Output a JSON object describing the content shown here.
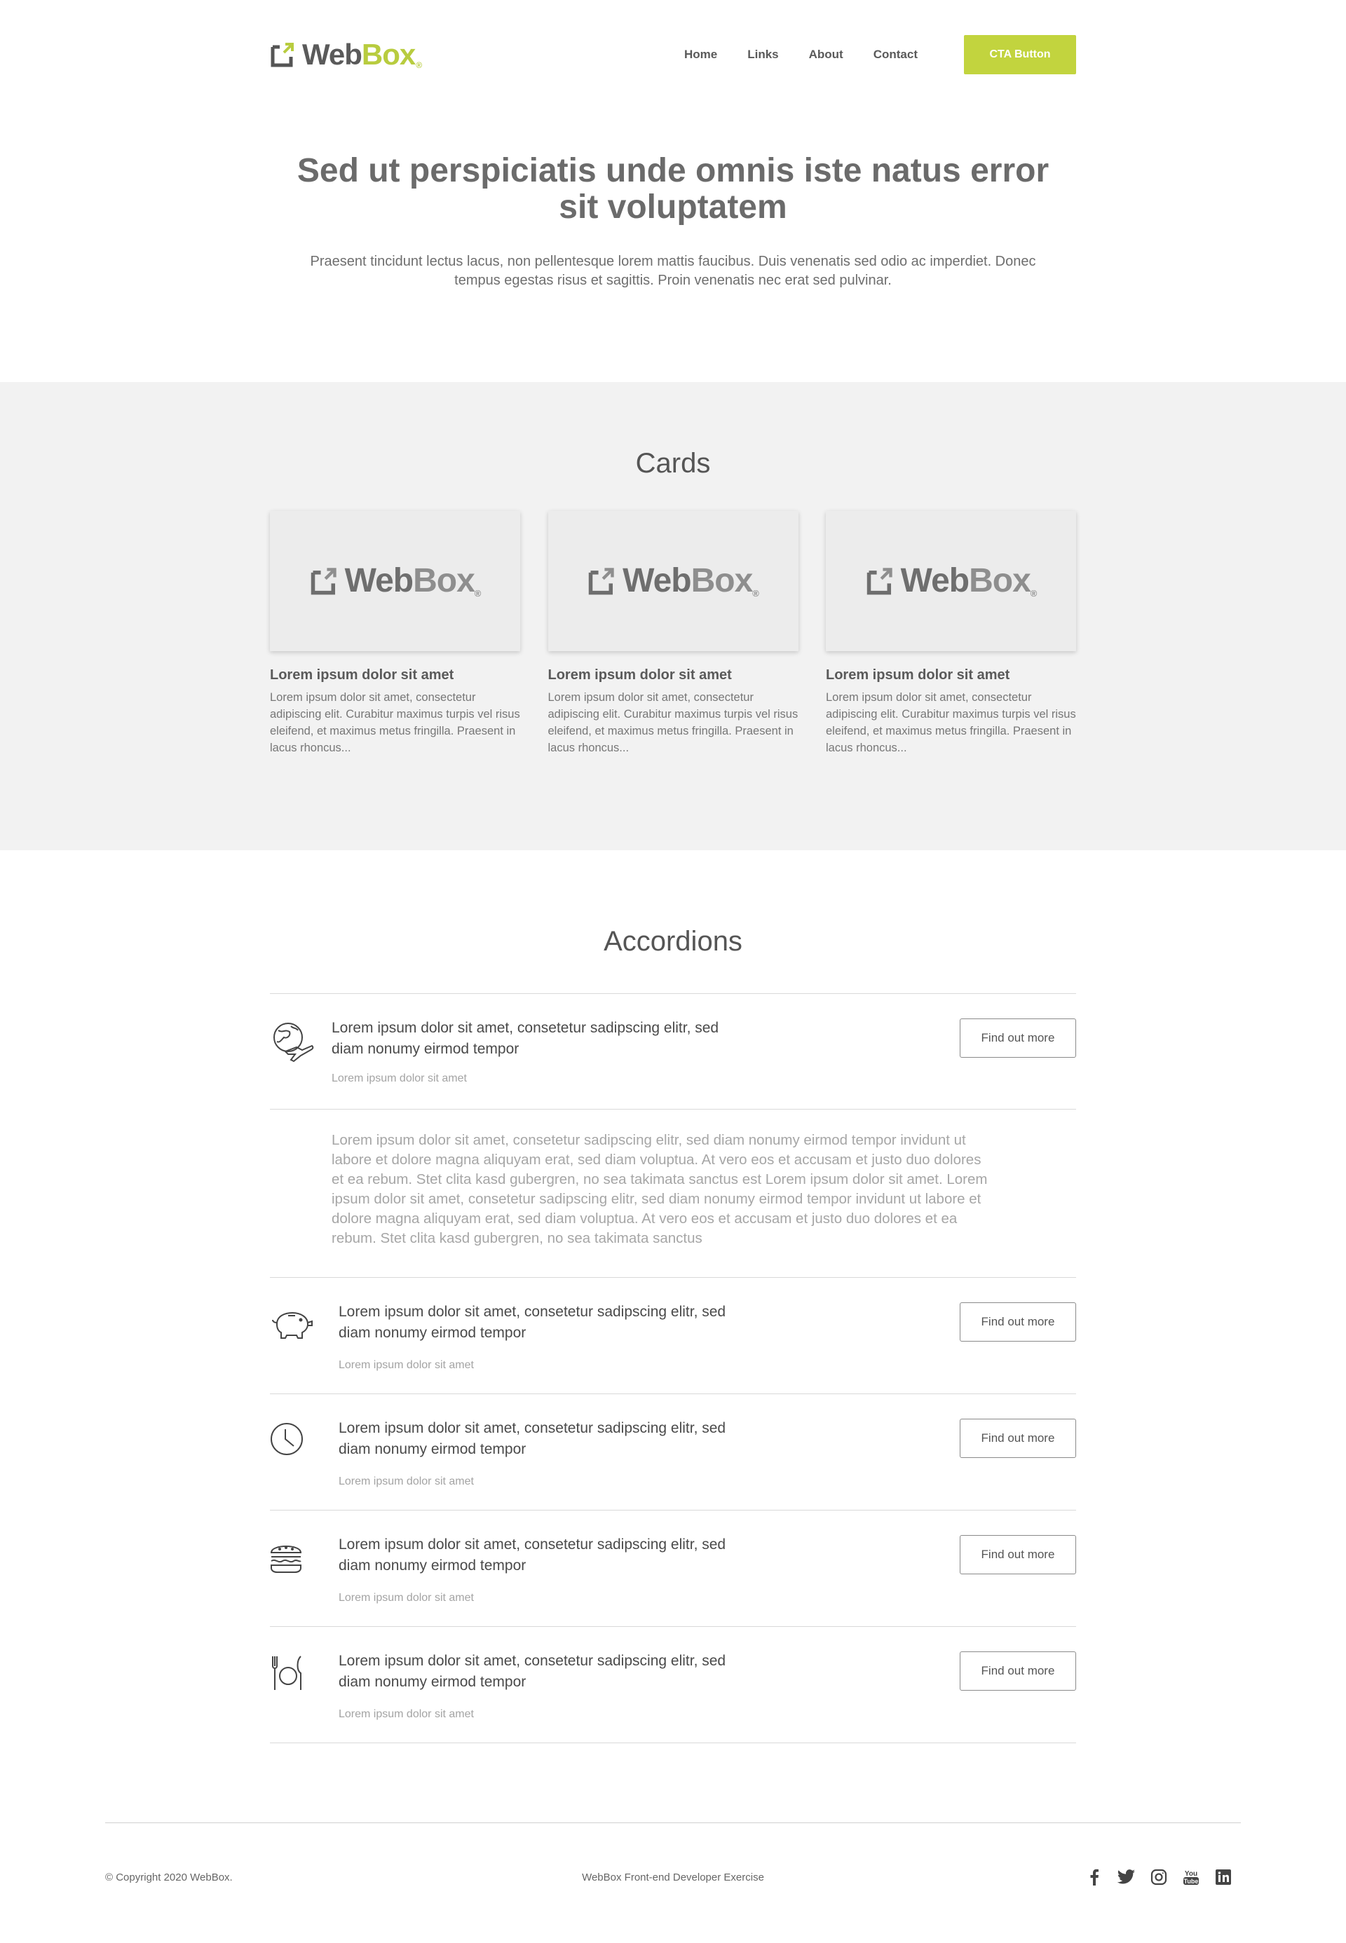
{
  "brand": {
    "name_part1": "Web",
    "name_part2": "Box",
    "reg": "®",
    "accent": "#c2d43e"
  },
  "nav": {
    "items": [
      "Home",
      "Links",
      "About",
      "Contact"
    ],
    "cta": "CTA Button"
  },
  "hero": {
    "title": "Sed ut perspiciatis unde omnis iste natus error sit voluptatem",
    "text": "Praesent tincidunt lectus lacus, non pellentesque lorem mattis faucibus. Duis venenatis sed odio ac imperdiet. Donec tempus egestas risus et sagittis. Proin venenatis nec erat sed pulvinar."
  },
  "cards_section": {
    "title": "Cards",
    "cards": [
      {
        "title": "Lorem ipsum dolor sit amet",
        "text": "Lorem ipsum dolor sit amet, consectetur adipiscing elit. Curabitur maximus turpis vel risus eleifend, et maximus metus fringilla. Praesent in lacus rhoncus..."
      },
      {
        "title": "Lorem ipsum dolor sit amet",
        "text": "Lorem ipsum dolor sit amet, consectetur adipiscing elit. Curabitur maximus turpis vel risus eleifend, et maximus metus fringilla. Praesent in lacus rhoncus..."
      },
      {
        "title": "Lorem ipsum dolor sit amet",
        "text": "Lorem ipsum dolor sit amet, consectetur adipiscing elit. Curabitur maximus turpis vel risus eleifend, et maximus metus fringilla. Praesent in lacus rhoncus..."
      }
    ]
  },
  "accordions": {
    "title": "Accordions",
    "items": [
      {
        "icon": "globe-plane-icon",
        "title": "Lorem ipsum dolor sit amet, consetetur sadipscing elitr, sed diam nonumy eirmod tempor",
        "subtitle": "Lorem ipsum dolor sit amet",
        "button": "Find out more",
        "expanded": true,
        "body": "Lorem ipsum dolor sit amet, consetetur sadipscing elitr, sed diam nonumy eirmod tempor invidunt ut labore et dolore magna aliquyam erat, sed diam voluptua. At vero eos et accusam et justo duo dolores et ea rebum. Stet clita kasd gubergren, no sea takimata sanctus est Lorem ipsum dolor sit amet. Lorem ipsum dolor sit amet, consetetur sadipscing elitr, sed diam nonumy eirmod tempor invidunt ut labore et dolore magna aliquyam erat, sed diam voluptua. At vero eos et accusam et justo duo dolores et ea rebum. Stet clita kasd gubergren, no sea takimata sanctus"
      },
      {
        "icon": "piggy-bank-icon",
        "title": "Lorem ipsum dolor sit amet, consetetur sadipscing elitr, sed diam nonumy eirmod tempor",
        "subtitle": "Lorem ipsum dolor sit amet",
        "button": "Find out more"
      },
      {
        "icon": "clock-icon",
        "title": "Lorem ipsum dolor sit amet, consetetur sadipscing elitr, sed diam nonumy eirmod tempor",
        "subtitle": "Lorem ipsum dolor sit amet",
        "button": "Find out more"
      },
      {
        "icon": "burger-icon",
        "title": "Lorem ipsum dolor sit amet, consetetur sadipscing elitr, sed diam nonumy eirmod tempor",
        "subtitle": "Lorem ipsum dolor sit amet",
        "button": "Find out more"
      },
      {
        "icon": "cutlery-icon",
        "title": "Lorem ipsum dolor sit amet, consetetur sadipscing elitr, sed diam nonumy eirmod tempor",
        "subtitle": "Lorem ipsum dolor sit amet",
        "button": "Find out more"
      }
    ]
  },
  "footer": {
    "copyright": "© Copyright 2020 WebBox.",
    "center": "WebBox Front-end Developer Exercise",
    "social": [
      "facebook-icon",
      "twitter-icon",
      "instagram-icon",
      "youtube-icon",
      "linkedin-icon"
    ]
  }
}
